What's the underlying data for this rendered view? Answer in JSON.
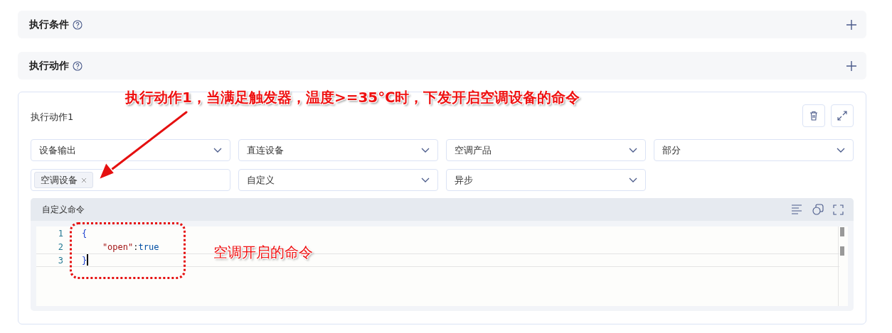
{
  "sections": [
    {
      "title": "执行条件",
      "expanded": false
    },
    {
      "title": "执行动作",
      "expanded": false
    }
  ],
  "action_card": {
    "title": "执行动作1",
    "fields": [
      {
        "kind": "select",
        "value": "设备输出"
      },
      {
        "kind": "select",
        "value": "直连设备"
      },
      {
        "kind": "select",
        "value": "空调产品"
      },
      {
        "kind": "select",
        "value": "部分"
      },
      {
        "kind": "tags",
        "tags": [
          "空调设备"
        ]
      },
      {
        "kind": "select",
        "value": "自定义"
      },
      {
        "kind": "select",
        "value": "异步"
      }
    ],
    "editor": {
      "title": "自定义命令",
      "lines": [
        {
          "number": "1",
          "current": false,
          "tokens": [
            {
              "kind": "punct",
              "text": "{"
            }
          ]
        },
        {
          "number": "2",
          "current": false,
          "tokens": [
            {
              "kind": "key",
              "text": "    \"open\""
            },
            {
              "kind": "plain",
              "text": ":"
            },
            {
              "kind": "value",
              "text": "true"
            }
          ]
        },
        {
          "number": "3",
          "current": true,
          "tokens": [
            {
              "kind": "punct",
              "text": "}"
            }
          ]
        }
      ]
    }
  },
  "annotations": [
    {
      "text": "执行动作1，当满足触发器，温度>=35℃时，下发开启空调设备的命令"
    },
    {
      "text": "空调开启的命令"
    }
  ]
}
